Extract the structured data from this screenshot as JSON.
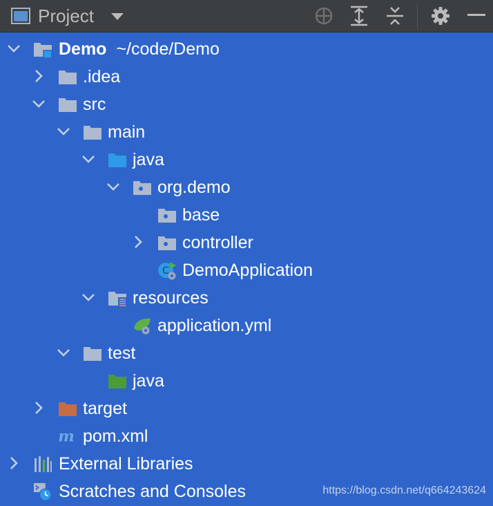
{
  "toolbar": {
    "title": "Project",
    "icons": [
      "project-view-icon",
      "dropdown-icon",
      "locate-icon",
      "expand-all-icon",
      "collapse-all-icon",
      "gear-icon",
      "hide-icon"
    ]
  },
  "tree": {
    "root_name": "Demo",
    "root_path": "~/code/Demo",
    "idea": ".idea",
    "src": "src",
    "main": "main",
    "main_java": "java",
    "package": "org.demo",
    "base": "base",
    "controller": "controller",
    "app_class": "DemoApplication",
    "resources": "resources",
    "app_yml": "application.yml",
    "test": "test",
    "test_java": "java",
    "target": "target",
    "pom": "pom.xml",
    "external_libraries": "External Libraries",
    "scratches": "Scratches and Consoles"
  },
  "watermark": "https://blog.csdn.net/q664243624",
  "colors": {
    "selection": "#2f65ca",
    "toolbar": "#3c3f41",
    "folder": "#aebad0",
    "source_folder": "#2f9ae7",
    "test_folder": "#4c9b3a",
    "excluded_folder": "#c86c44"
  }
}
